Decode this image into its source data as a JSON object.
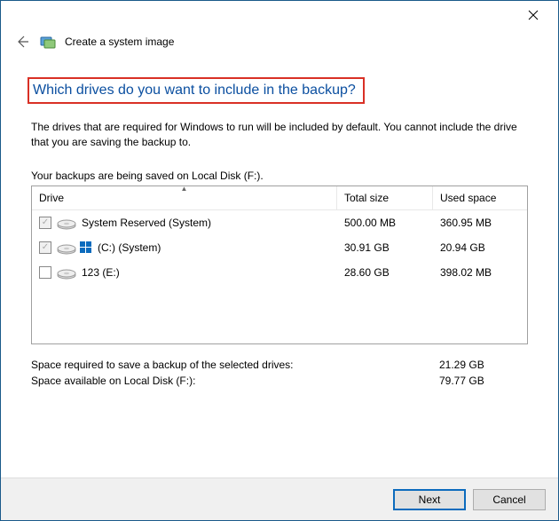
{
  "window": {
    "title": "Create a system image"
  },
  "heading": "Which drives do you want to include in the backup?",
  "description": "The drives that are required for Windows to run will be included by default. You cannot include the drive that you are saving the backup to.",
  "saving_info": "Your backups are being saved on Local Disk (F:).",
  "columns": {
    "drive": "Drive",
    "total": "Total size",
    "used": "Used space"
  },
  "drives": [
    {
      "label": "System Reserved (System)",
      "total": "500.00 MB",
      "used": "360.95 MB",
      "checked": true,
      "disabled": true,
      "winflag": false
    },
    {
      "label": "(C:) (System)",
      "total": "30.91 GB",
      "used": "20.94 GB",
      "checked": true,
      "disabled": true,
      "winflag": true
    },
    {
      "label": "123 (E:)",
      "total": "28.60 GB",
      "used": "398.02 MB",
      "checked": false,
      "disabled": false,
      "winflag": false
    }
  ],
  "summary": {
    "required_label": "Space required to save a backup of the selected drives:",
    "required_value": "21.29 GB",
    "available_label": "Space available on Local Disk (F:):",
    "available_value": "79.77 GB"
  },
  "buttons": {
    "next": "Next",
    "cancel": "Cancel"
  }
}
